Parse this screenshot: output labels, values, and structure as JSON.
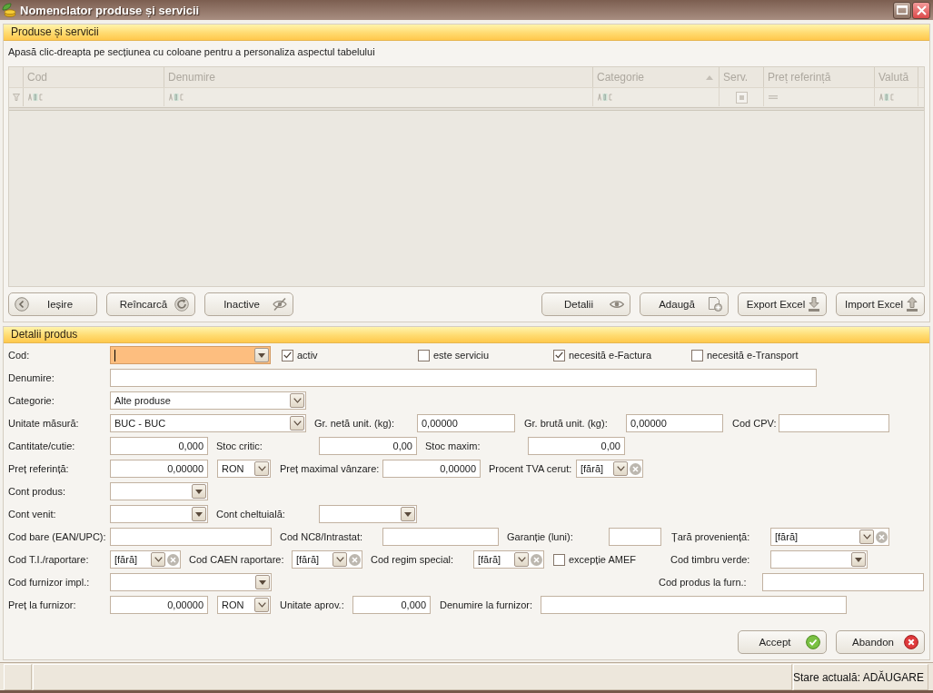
{
  "window": {
    "title": "Nomenclator produse și servicii"
  },
  "products": {
    "title": "Produse și servicii",
    "hint": "Apasă clic-dreapta pe secțiunea cu coloane pentru a personaliza aspectul tabelului",
    "table": {
      "columns": [
        {
          "label": "Cod",
          "kind": "text",
          "sorted": false
        },
        {
          "label": "Denumire",
          "kind": "text",
          "sorted": false
        },
        {
          "label": "Categorie",
          "kind": "text",
          "sorted": true
        },
        {
          "label": "Serv.",
          "kind": "boolean",
          "sorted": false
        },
        {
          "label": "Preț referință",
          "kind": "number",
          "sorted": false
        },
        {
          "label": "Valută",
          "kind": "text",
          "sorted": false
        }
      ]
    },
    "left_buttons": [
      "Ieșire",
      "Reîncarcă",
      "Inactive"
    ],
    "right_buttons": [
      "Detalii",
      "Adaugă",
      "Export Excel",
      "Import Excel"
    ]
  },
  "details": {
    "title": "Detalii produs",
    "rows": [
      {
        "items": [
          {
            "kind": "label",
            "text": "Cod:"
          },
          {
            "kind": "lookup",
            "focused": true
          },
          {
            "kind": "checkbox",
            "label": "activ",
            "checked": true
          },
          {
            "kind": "checkbox",
            "label": "este serviciu",
            "checked": false
          },
          {
            "kind": "checkbox",
            "label": "necesită e-Factura",
            "checked": true
          },
          {
            "kind": "checkbox",
            "label": "necesită e-Transport",
            "checked": false
          }
        ]
      },
      {
        "items": [
          {
            "kind": "label",
            "text": "Denumire:"
          },
          {
            "kind": "text",
            "focused": false
          }
        ]
      },
      {
        "items": [
          {
            "kind": "label",
            "text": "Categorie:"
          },
          {
            "kind": "dropdown",
            "value": "Alte produse",
            "focused": false
          }
        ]
      },
      {
        "items": [
          {
            "kind": "label",
            "text": "Unitate măsură:"
          },
          {
            "kind": "dropdown",
            "value": "BUC - BUC",
            "focused": false
          },
          {
            "kind": "label",
            "text": "Gr. netă unit. (kg):"
          },
          {
            "kind": "text",
            "value": "0,00000",
            "focused": false
          },
          {
            "kind": "label",
            "text": "Gr. brută unit. (kg):"
          },
          {
            "kind": "text",
            "value": "0,00000",
            "focused": false
          },
          {
            "kind": "label",
            "text": "Cod CPV:"
          },
          {
            "kind": "text",
            "focused": false
          }
        ]
      },
      {
        "items": [
          {
            "kind": "label",
            "text": "Cantitate/cutie:"
          },
          {
            "kind": "number",
            "value": "0,000",
            "focused": false
          },
          {
            "kind": "label",
            "text": "Stoc critic:"
          },
          {
            "kind": "number",
            "value": "0,00",
            "focused": false
          },
          {
            "kind": "label",
            "text": "Stoc maxim:"
          },
          {
            "kind": "number",
            "value": "0,00",
            "focused": false
          }
        ]
      },
      {
        "items": [
          {
            "kind": "label",
            "text": "Preț referință:"
          },
          {
            "kind": "number",
            "value": "0,00000",
            "focused": false
          },
          {
            "kind": "dropdown",
            "value": "RON",
            "focused": false
          },
          {
            "kind": "label",
            "text": "Preț maximal vânzare:"
          },
          {
            "kind": "number",
            "value": "0,00000",
            "focused": false
          },
          {
            "kind": "label",
            "text": "Procent TVA cerut:"
          },
          {
            "kind": "clearable",
            "value": "[fără]",
            "focused": false
          }
        ]
      },
      {
        "items": [
          {
            "kind": "label",
            "text": "Cont produs:"
          },
          {
            "kind": "lookup",
            "focused": false
          }
        ]
      },
      {
        "items": [
          {
            "kind": "label",
            "text": "Cont venit:"
          },
          {
            "kind": "lookup",
            "focused": false
          },
          {
            "kind": "label",
            "text": "Cont cheltuială:"
          },
          {
            "kind": "lookup",
            "focused": false
          }
        ]
      },
      {
        "items": [
          {
            "kind": "label",
            "text": "Cod bare (EAN/UPC):"
          },
          {
            "kind": "text",
            "focused": false
          },
          {
            "kind": "label",
            "text": "Cod NC8/Intrastat:"
          },
          {
            "kind": "text",
            "focused": false
          },
          {
            "kind": "label",
            "text": "Garanție (luni):"
          },
          {
            "kind": "text",
            "focused": false
          },
          {
            "kind": "label",
            "text": "Țară proveniență:"
          },
          {
            "kind": "clearable",
            "value": "[fără]",
            "focused": false
          }
        ]
      },
      {
        "items": [
          {
            "kind": "label",
            "text": "Cod T.I./raportare:"
          },
          {
            "kind": "clearable",
            "value": "[fără]",
            "focused": false
          },
          {
            "kind": "label",
            "text": "Cod CAEN raportare:"
          },
          {
            "kind": "clearable",
            "value": "[fără]",
            "focused": false
          },
          {
            "kind": "label",
            "text": "Cod regim special:"
          },
          {
            "kind": "clearable",
            "value": "[fără]",
            "focused": false
          },
          {
            "kind": "checkbox",
            "label": "excepție AMEF",
            "checked": false
          },
          {
            "kind": "label",
            "text": "Cod timbru verde:"
          },
          {
            "kind": "lookup",
            "focused": false
          }
        ]
      },
      {
        "items": [
          {
            "kind": "label",
            "text": "Cod furnizor impl.:"
          },
          {
            "kind": "lookup",
            "focused": false
          },
          {
            "kind": "label",
            "text": "Cod produs la furn.:"
          },
          {
            "kind": "text",
            "focused": false
          }
        ]
      },
      {
        "items": [
          {
            "kind": "label",
            "text": "Preț la furnizor:"
          },
          {
            "kind": "number",
            "value": "0,00000",
            "focused": false
          },
          {
            "kind": "dropdown",
            "value": "RON",
            "focused": false
          },
          {
            "kind": "label",
            "text": "Unitate aprov.:"
          },
          {
            "kind": "number",
            "value": "0,000",
            "focused": false
          },
          {
            "kind": "label",
            "text": "Denumire la furnizor:"
          },
          {
            "kind": "text",
            "focused": false
          }
        ]
      }
    ],
    "buttons": [
      "Accept",
      "Abandon"
    ]
  },
  "status_bar": {
    "state": "Stare actuală: ADĂUGARE"
  }
}
